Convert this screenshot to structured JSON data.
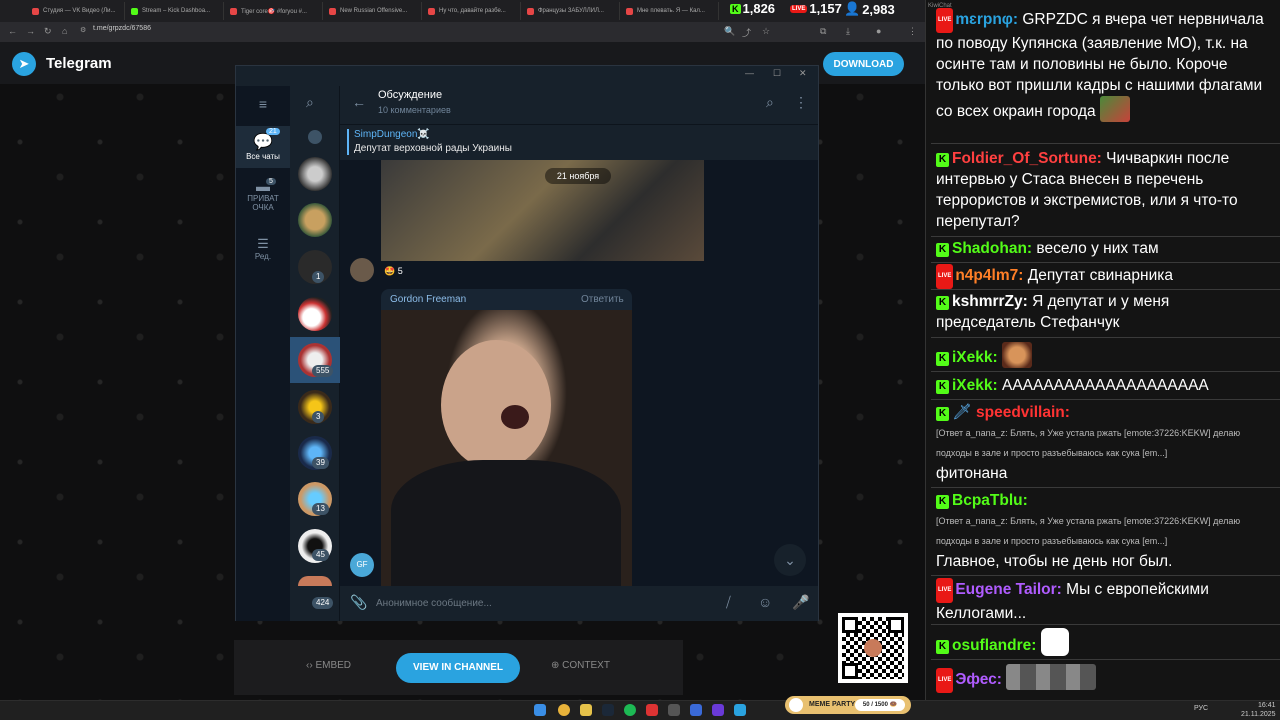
{
  "browser": {
    "tabs": [
      {
        "label": "Студия — VK Видео (Ли...",
        "color": "#e64646"
      },
      {
        "label": "Stream – Kick Dashboa...",
        "color": "#53fc18"
      },
      {
        "label": "Tiger core🎯 #foryou #...",
        "color": "#e64646"
      },
      {
        "label": "New Russian Offensive...",
        "color": "#e64646"
      },
      {
        "label": "Ну что, давайте разбе...",
        "color": "#e64646"
      },
      {
        "label": "Французы ЗАБУЛЛИЛ...",
        "color": "#e64646"
      },
      {
        "label": "Мне плевать. Я — Кал...",
        "color": "#e64646"
      }
    ],
    "url": "t.me/grpzdc/67586"
  },
  "counters": {
    "kick": "1,826",
    "twitch": "1,157",
    "viewers": "2,983"
  },
  "telegram_web": {
    "brand": "Telegram",
    "download_label": "DOWNLOAD",
    "embed_label": "EMBED",
    "view_label": "VIEW IN CHANNEL",
    "context_label": "CONTEXT"
  },
  "tg_desktop": {
    "rail": {
      "all_chats_label": "Все чаты",
      "all_chats_count": "21",
      "private_label": "ПРИВАТ ОЧКА",
      "private_count": "5",
      "edit_label": "Ред."
    },
    "chat_badges": [
      "1",
      "555",
      "3",
      "39",
      "13",
      "45",
      "424"
    ],
    "chat_title": "Обсуждение",
    "chat_subtitle": "10 комментариев",
    "pinned_title": "SimpDungeon☠️",
    "pinned_text": "Депутат верховной рады Украины",
    "date_pill": "21 ноября",
    "reaction": "🤩 5",
    "message_sender": "Gordon Freeman",
    "reply_label": "Ответить",
    "gif_avatar": "GF",
    "composer_placeholder": "Анонимное сообщение..."
  },
  "chat": {
    "overlay_title": "KiwiChat",
    "messages": [
      {
        "platform": "twitch",
        "user": "mɛrpnφ:",
        "user_color": "#2aa3e0",
        "text": "GRPZDC я вчера чет нервничала по поводу Купянска (заявление МО), т.к. на осинте там и половины не было. Короче только вот пришли кадры с нашими флагами со всех окраин города"
      },
      {
        "platform": "kick",
        "user": "Foldier_Of_Sortune:",
        "user_color": "#ff4040",
        "text": "Чичваркин после интервью у Стаса внесен в перечень террористов и экстремистов, или я что-то перепутал?"
      },
      {
        "platform": "kick",
        "user": "Shadohan:",
        "user_color": "#53fc18",
        "text": "весело у них там"
      },
      {
        "platform": "twitch",
        "user": "n4p4lm7:",
        "user_color": "#ff7f27",
        "text": "Депутат свинарника"
      },
      {
        "platform": "kick",
        "user": "kshmrrZy:",
        "user_color": "#ffffff",
        "text": "Я депутат и у меня председатель Стефанчук"
      },
      {
        "platform": "kick",
        "user": "iXekk:",
        "user_color": "#53fc18",
        "text": ""
      },
      {
        "platform": "kick",
        "user": "iXekk:",
        "user_color": "#53fc18",
        "text": "АААААААААААААААААААА"
      },
      {
        "platform": "kick",
        "user": "speedvillain:",
        "user_color": "#ff3333",
        "reply": "[Ответ a_nana_z: Блять, я Уже устала ржать [emote:37226:KEKW] делаю подходы в зале и просто разъебываюсь как сука [em...]",
        "text": "фитонана"
      },
      {
        "platform": "kick",
        "user": "BcpaTblu:",
        "user_color": "#53fc18",
        "reply": "[Ответ a_nana_z: Блять, я Уже устала ржать [emote:37226:KEKW] делаю подходы в зале и просто разъебываюсь как сука [em...]",
        "text": "Главное, чтобы не день ног был."
      },
      {
        "platform": "twitch",
        "user": "Eugene Tailor:",
        "user_color": "#b05cff",
        "text": "Мы с европейскими Келлогами..."
      },
      {
        "platform": "kick",
        "user": "osuflandre:",
        "user_color": "#53fc18",
        "text": ""
      },
      {
        "platform": "twitch",
        "user": "Эфес:",
        "user_color": "#b05cff",
        "text": ""
      }
    ]
  },
  "taskbar": {
    "lang": "РУС",
    "time": "16:41",
    "date": "21.11.2025",
    "meme_party": "MEME PARTY",
    "meme_progress": "50 / 1500 🍩"
  }
}
